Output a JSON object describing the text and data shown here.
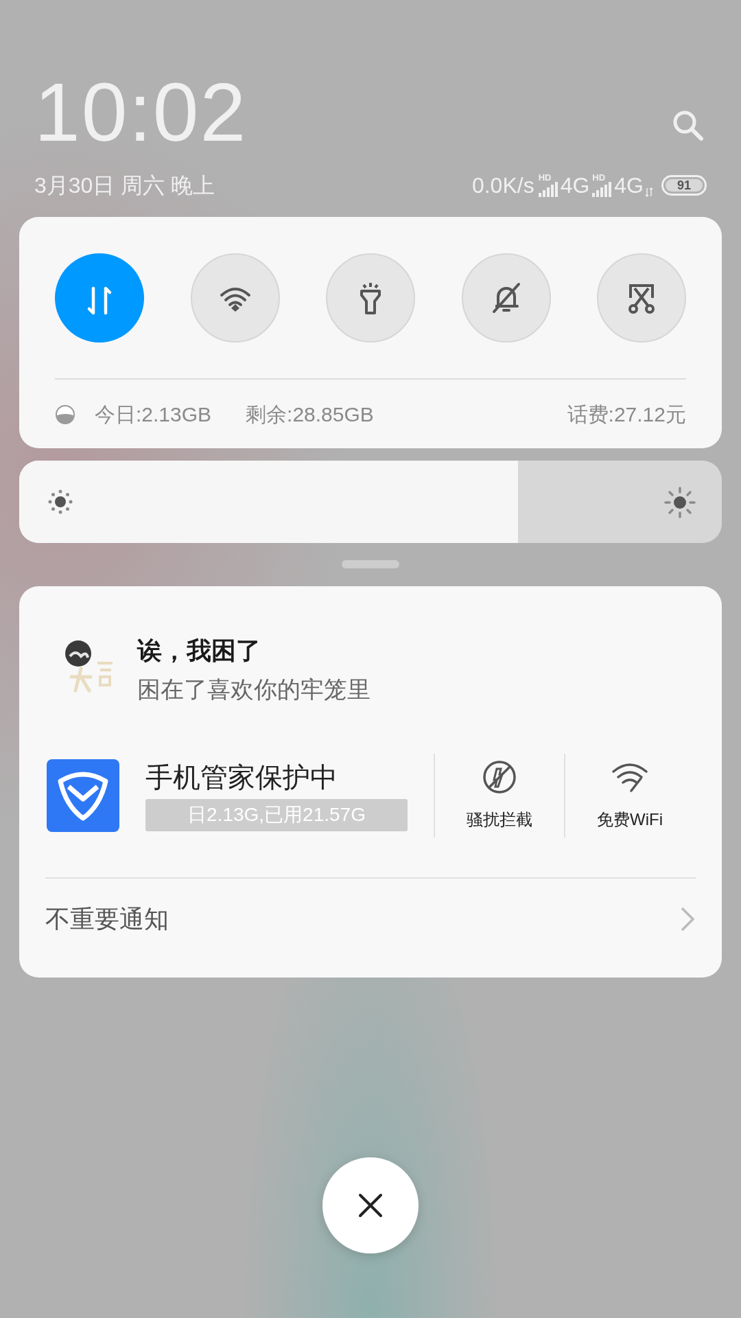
{
  "clock": {
    "time": "10:02",
    "date": "3月30日 周六 晚上"
  },
  "status_bar": {
    "net_speed": "0.0K/s",
    "sims": [
      {
        "hd": "HD",
        "network": "4G"
      },
      {
        "hd": "HD",
        "network": "4G",
        "activity": true
      }
    ],
    "battery": "91"
  },
  "toggles": [
    {
      "kind": "data",
      "on": true
    },
    {
      "kind": "wifi",
      "on": false
    },
    {
      "kind": "flashlight",
      "on": false
    },
    {
      "kind": "silent",
      "on": false
    },
    {
      "kind": "screenshot",
      "on": false
    }
  ],
  "data_usage": {
    "today": "今日:2.13GB",
    "remaining": "剩余:28.85GB",
    "fee": "话费:27.12元"
  },
  "brightness": {
    "level": 0.71
  },
  "notification": {
    "title": "诶，我困了",
    "text": "困在了喜欢你的牢笼里"
  },
  "guard": {
    "title": "手机管家保护中",
    "usage": "日2.13G,已用21.57G",
    "actions": [
      {
        "kind": "block",
        "label": "骚扰拦截"
      },
      {
        "kind": "wifi",
        "label": "免费WiFi"
      }
    ]
  },
  "footer": {
    "label": "不重要通知"
  }
}
